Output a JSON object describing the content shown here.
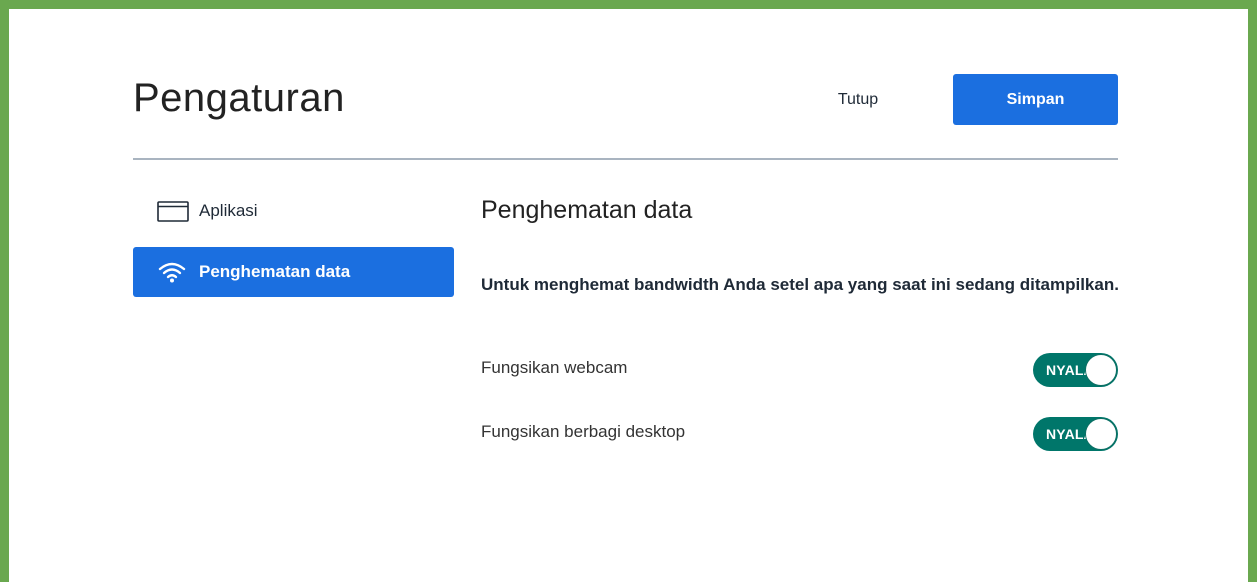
{
  "header": {
    "title": "Pengaturan",
    "close_label": "Tutup",
    "save_label": "Simpan"
  },
  "sidebar": {
    "items": [
      {
        "label": "Aplikasi",
        "icon": "window-icon",
        "active": false
      },
      {
        "label": "Penghematan data",
        "icon": "wifi-icon",
        "active": true
      }
    ]
  },
  "main": {
    "section_title": "Penghematan data",
    "description": "Untuk menghemat bandwidth Anda setel apa yang saat ini sedang ditampilkan.",
    "settings": [
      {
        "label": "Fungsikan webcam",
        "toggle_label": "NYALA",
        "state": "on"
      },
      {
        "label": "Fungsikan berbagi desktop",
        "toggle_label": "NYALA",
        "state": "on"
      }
    ]
  },
  "colors": {
    "frame": "#6aa84f",
    "primary": "#1b6fe0",
    "toggle_on": "#00766a"
  }
}
